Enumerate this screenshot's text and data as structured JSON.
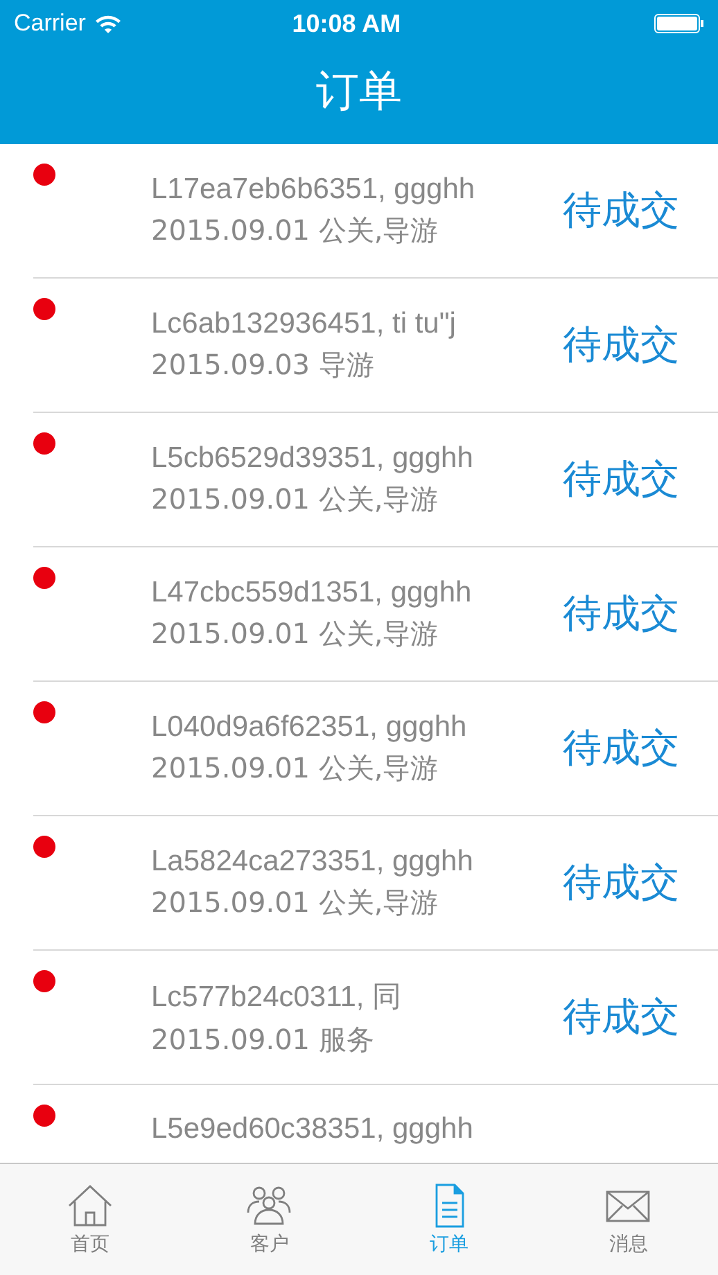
{
  "status_bar": {
    "carrier": "Carrier",
    "time": "10:08 AM"
  },
  "nav": {
    "title": "订单"
  },
  "orders": [
    {
      "line1": "L17ea7eb6b6351, ggghh",
      "line2": "2015.09.01 公关,导游",
      "status": "待成交"
    },
    {
      "line1": "Lc6ab132936451, ti tu\"j",
      "line2": "2015.09.03 导游",
      "status": "待成交"
    },
    {
      "line1": "L5cb6529d39351, ggghh",
      "line2": "2015.09.01 公关,导游",
      "status": "待成交"
    },
    {
      "line1": "L47cbc559d1351, ggghh",
      "line2": "2015.09.01 公关,导游",
      "status": "待成交"
    },
    {
      "line1": "L040d9a6f62351, ggghh",
      "line2": "2015.09.01 公关,导游",
      "status": "待成交"
    },
    {
      "line1": "La5824ca273351, ggghh",
      "line2": "2015.09.01 公关,导游",
      "status": "待成交"
    },
    {
      "line1": "Lc577b24c0311, 同",
      "line2": "2015.09.01 服务",
      "status": "待成交"
    },
    {
      "line1": "L5e9ed60c38351, ggghh"
    }
  ],
  "tab_bar": [
    {
      "kind": "home",
      "label": "首页",
      "selected": false
    },
    {
      "kind": "customers",
      "label": "客户",
      "selected": false
    },
    {
      "kind": "orders",
      "label": "订单",
      "selected": true
    },
    {
      "kind": "messages",
      "label": "消息",
      "selected": false
    }
  ]
}
